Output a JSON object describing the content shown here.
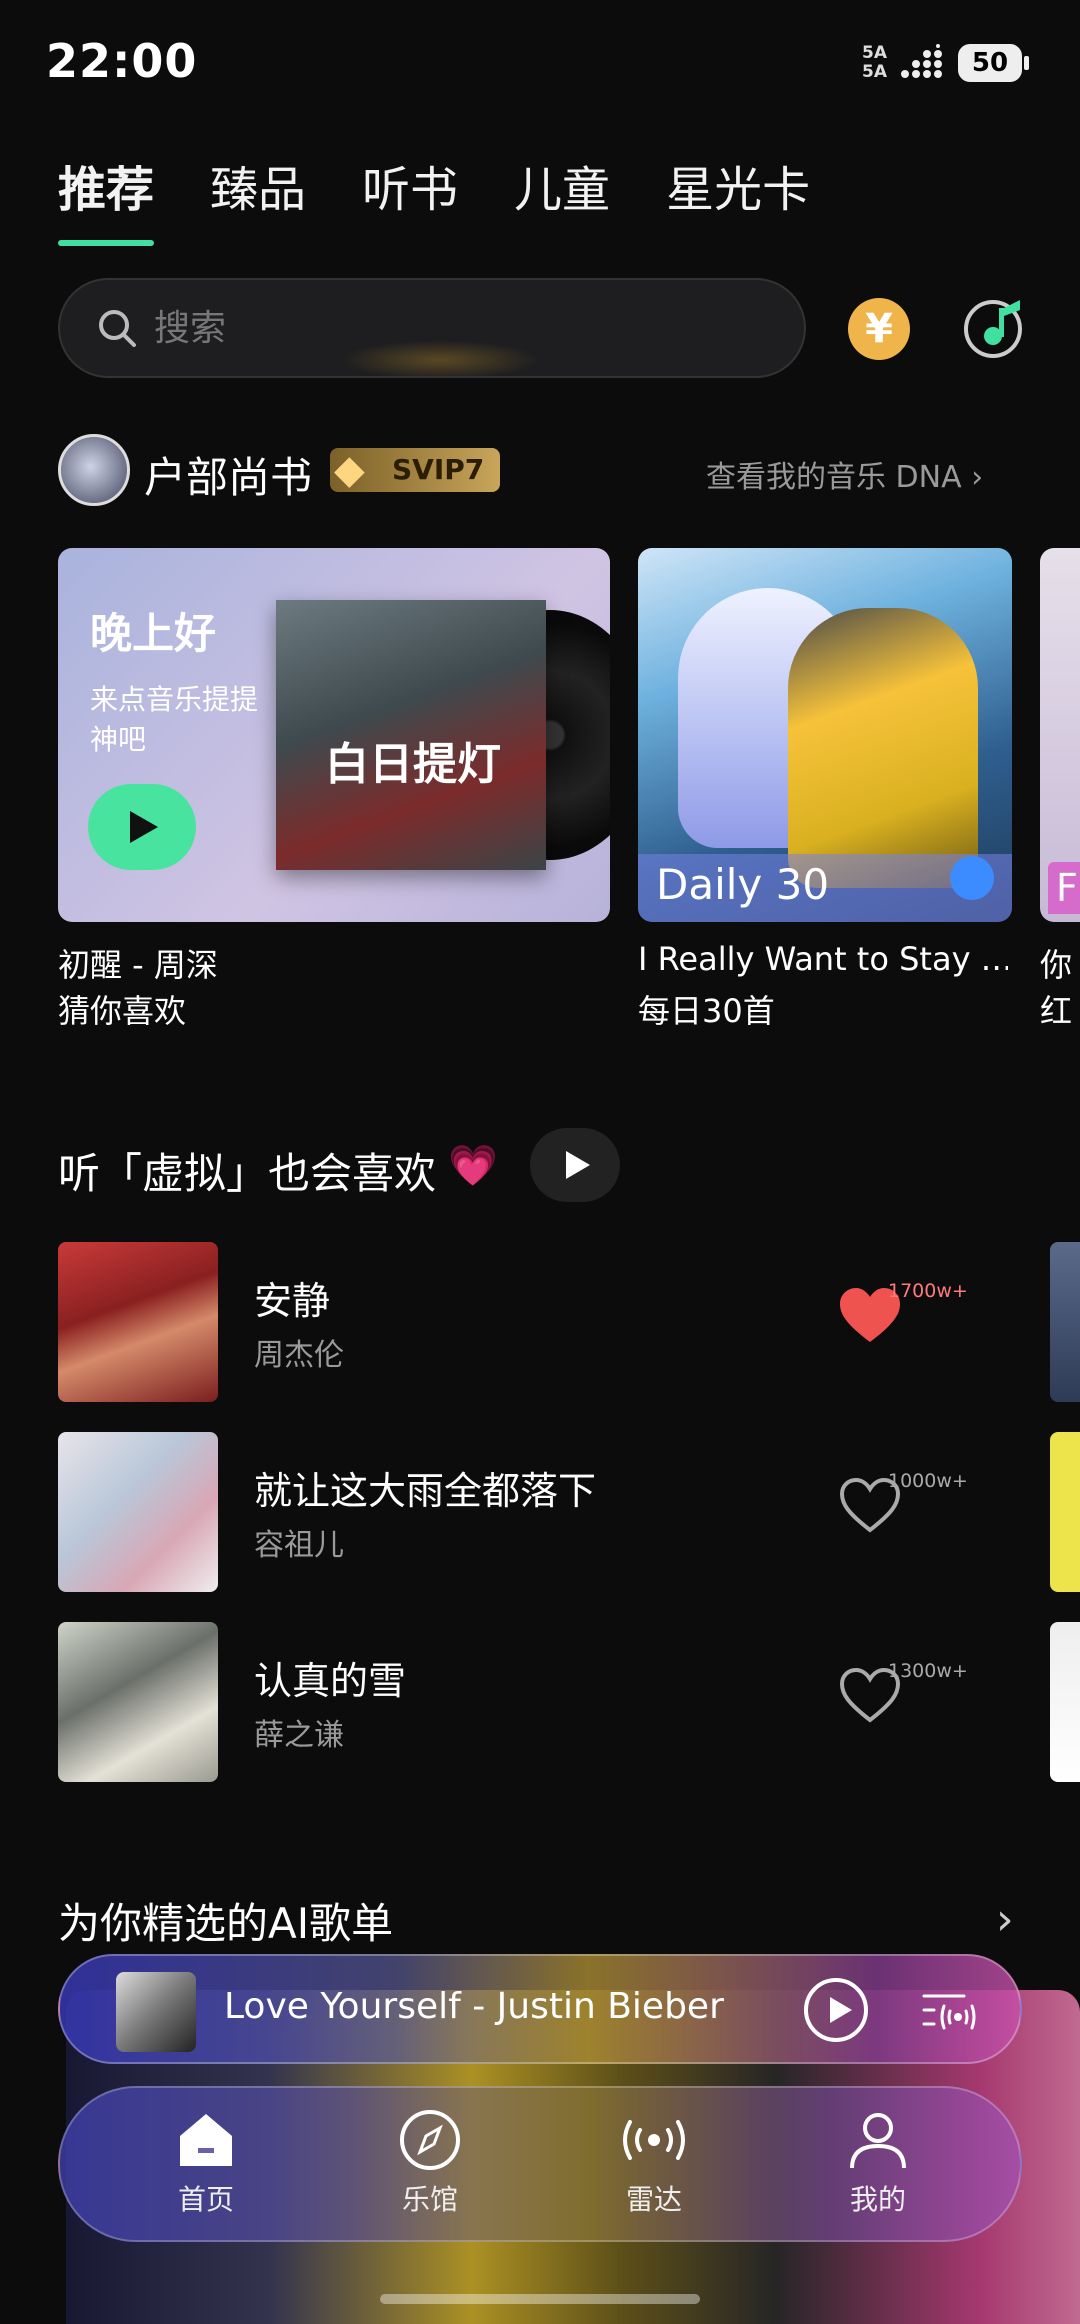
{
  "status_bar": {
    "time": "22:00",
    "signal_1": "5A",
    "signal_2": "5A",
    "battery": "50"
  },
  "tabs": [
    {
      "label": "推荐",
      "active": true
    },
    {
      "label": "臻品",
      "active": false
    },
    {
      "label": "听书",
      "active": false
    },
    {
      "label": "儿童",
      "active": false
    },
    {
      "label": "星光卡",
      "active": false
    }
  ],
  "search": {
    "placeholder": "搜索"
  },
  "header_icons": {
    "coin": "¥",
    "coin_icon": "yuan-coin-icon",
    "music_icon": "music-disc-icon"
  },
  "user": {
    "name": "户部尚书",
    "vip": "SVIP7",
    "dna_link": "查看我的音乐 DNA"
  },
  "cards": [
    {
      "greeting": "晚上好",
      "subtitle": "来点音乐提提神吧",
      "album_title": "白日提灯",
      "song": "初醒 - 周深",
      "caption": "猜你喜欢"
    },
    {
      "label": "Daily 30",
      "song": "I Really Want to Stay …",
      "caption": "每日30首"
    },
    {
      "label": "F",
      "song": "你",
      "caption": "红"
    }
  ],
  "recommend": {
    "title": "听「虚拟」也会喜欢",
    "emoji": "💗"
  },
  "songs": [
    {
      "title": "安静",
      "artist": "周杰伦",
      "likes": "1700w+",
      "liked": true
    },
    {
      "title": "就让这大雨全都落下",
      "artist": "容祖儿",
      "likes": "1000w+",
      "liked": false
    },
    {
      "title": "认真的雪",
      "artist": "薛之谦",
      "likes": "1300w+",
      "liked": false
    }
  ],
  "ai_playlist": {
    "title": "为你精选的AI歌单"
  },
  "mini_player": {
    "title": "Love Yourself - Justin Bieber"
  },
  "nav": [
    {
      "label": "首页",
      "icon": "home-icon",
      "active": true
    },
    {
      "label": "乐馆",
      "icon": "compass-icon",
      "active": false
    },
    {
      "label": "雷达",
      "icon": "radar-icon",
      "active": false
    },
    {
      "label": "我的",
      "icon": "profile-icon",
      "active": false
    }
  ],
  "colors": {
    "accent": "#3fe0a0",
    "background": "#0c0c0d",
    "heart": "#ef5350",
    "coin": "#f0b54a"
  }
}
